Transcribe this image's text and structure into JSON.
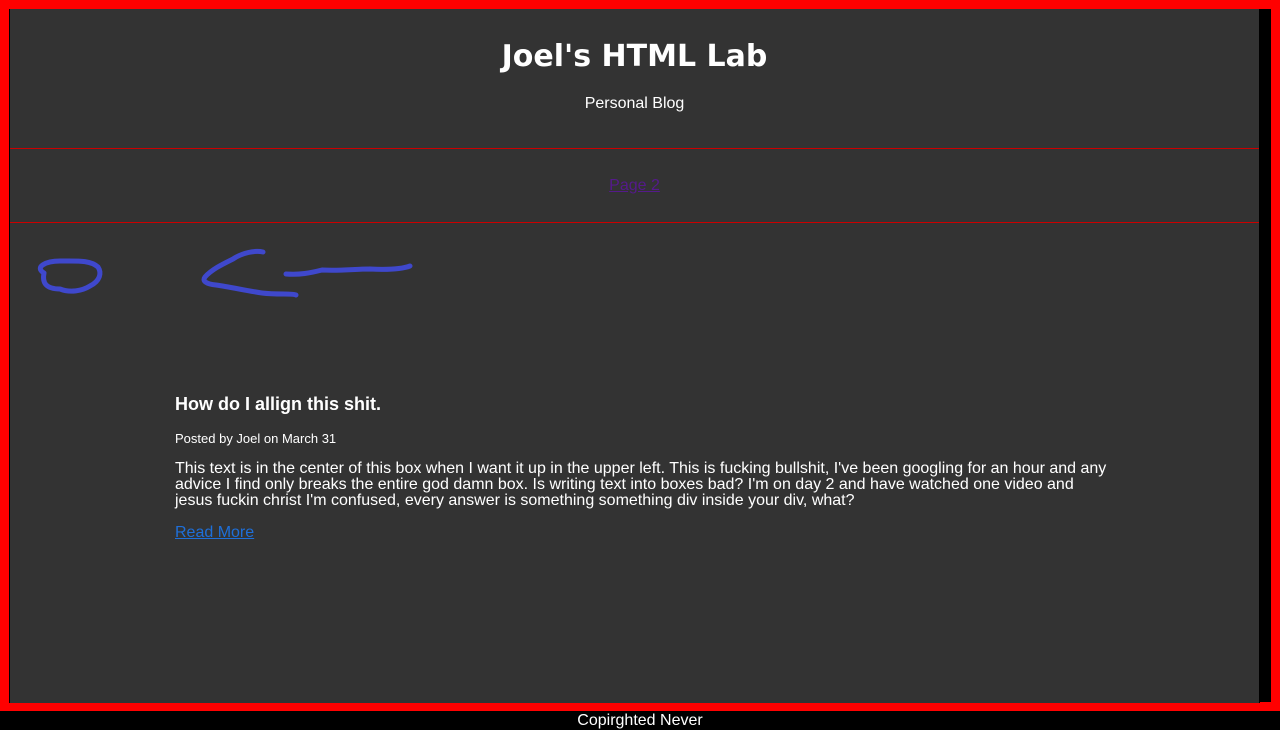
{
  "header": {
    "title": "Joel's HTML Lab",
    "subtitle": "Personal Blog"
  },
  "nav": {
    "link_label": "Page 2"
  },
  "post": {
    "title": "How do I allign this shit.",
    "meta": "Posted by Joel on March 31",
    "body": "This text is in the center of this box when I want it up in the upper left. This is fucking bullshit, I've been googling for an hour and any advice I find only breaks the entire god damn box. Is writing text into boxes bad? I'm on day 2 and have watched one video and jesus fuckin christ I'm confused, every answer is something something div inside your div, what?",
    "read_more": "Read More"
  },
  "footer": {
    "text": "Copirghted Never"
  },
  "colors": {
    "border": "#ff0000",
    "panel": "#333333",
    "divider": "#cc0000",
    "visited_link": "#551a8b",
    "link": "#1e6fd9",
    "scribble": "#3f48cc"
  }
}
